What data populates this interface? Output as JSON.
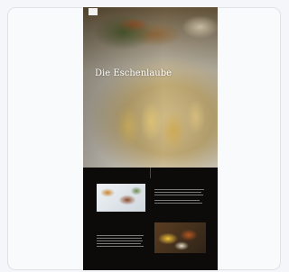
{
  "header": {
    "logo_text": "",
    "nav": [
      "",
      "",
      "",
      "",
      ""
    ]
  },
  "hero": {
    "title": "Die Eschenlaube",
    "subtitle": "",
    "cta": ""
  },
  "section_one": {
    "title": ""
  },
  "section_two": {
    "title_line1": "",
    "title_line2": ""
  },
  "colors": {
    "page": "#f4f6f9",
    "preview_bg": "#0d0b09",
    "hero_text": "#ffffff"
  }
}
